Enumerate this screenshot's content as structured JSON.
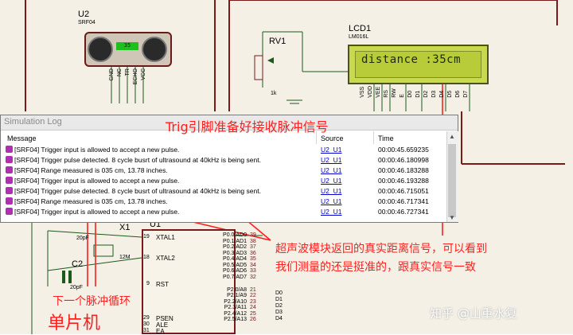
{
  "u2": {
    "ref": "U2",
    "part": "SRF04",
    "display": "35",
    "pins": [
      "GND",
      "NC",
      "TR",
      "ECHO",
      "VCC"
    ]
  },
  "rv1": {
    "ref": "RV1",
    "value": "1k"
  },
  "lcd": {
    "ref": "LCD1",
    "part": "LM016L",
    "text": "distance :35cm",
    "pins": [
      "VSS",
      "VDD",
      "VEE",
      "RS",
      "RW",
      "E",
      "D0",
      "D1",
      "D2",
      "D3",
      "D4",
      "D5",
      "D6",
      "D7"
    ]
  },
  "log": {
    "title": "Simulation Log",
    "columns": {
      "message": "Message",
      "source": "Source",
      "time": "Time"
    },
    "rows": [
      {
        "message": "[SRF04] Trigger input is allowed to accept a new pulse.",
        "source": "U2_U1",
        "time": "00:00:45.659235"
      },
      {
        "message": "[SRF04] Trigger pulse detected. 8 cycle busrt of ultrasound at 40kHz is being sent.",
        "source": "U2_U1",
        "time": "00:00:46.180998"
      },
      {
        "message": "[SRF04] Range measured is 035 cm, 13.78 inches.",
        "source": "U2_U1",
        "time": "00:00:46.183288"
      },
      {
        "message": "[SRF04] Trigger input is allowed to accept a new pulse.",
        "source": "U2_U1",
        "time": "00:00:46.193288"
      },
      {
        "message": "[SRF04] Trigger pulse detected. 8 cycle busrt of ultrasound at 40kHz is being sent.",
        "source": "U2_U1",
        "time": "00:00:46.715051"
      },
      {
        "message": "[SRF04] Range measured is 035 cm, 13.78 inches.",
        "source": "U2_U1",
        "time": "00:00:46.717341"
      },
      {
        "message": "[SRF04] Trigger input is allowed to accept a new pulse.",
        "source": "U2_U1",
        "time": "00:00:46.727341"
      }
    ]
  },
  "mcu": {
    "ref": "U1",
    "left_pins": [
      "XTAL1",
      "XTAL2",
      "RST",
      "PSEN",
      "ALE",
      "EA"
    ],
    "right_pins": [
      "P0.0/AD0",
      "P0.1/AD1",
      "P0.2/AD2",
      "P0.3/AD3",
      "P0.4/AD4",
      "P0.5/AD5",
      "P0.6/AD6",
      "P0.7/AD7",
      "P2.0/A8",
      "P2.1/A9",
      "P2.2/A10",
      "P2.3/A11",
      "P2.4/A12",
      "P2.5/A13"
    ],
    "right_nets": [
      "D0",
      "D1",
      "D2",
      "D3",
      "D4"
    ],
    "left_nums": [
      "19",
      "18",
      "9",
      "29",
      "30",
      "31"
    ],
    "right_nums": [
      "39",
      "38",
      "37",
      "36",
      "35",
      "34",
      "33",
      "32",
      "21",
      "22",
      "23",
      "24",
      "25",
      "26"
    ]
  },
  "crystal": {
    "x1": "X1",
    "x1_value": "12M",
    "c2": "C2",
    "c_value": "20pF"
  },
  "annotations": {
    "trig": "Trig引脚准备好接收脉冲信号",
    "echo_line1": "超声波模块返回的真实距离信号，可以看到",
    "echo_line2": "我们测量的还是挺准的，跟真实信号一致",
    "next_cycle": "下一个脉冲循环",
    "mcu": "单片机"
  },
  "watermark": "知乎 @山重水复"
}
